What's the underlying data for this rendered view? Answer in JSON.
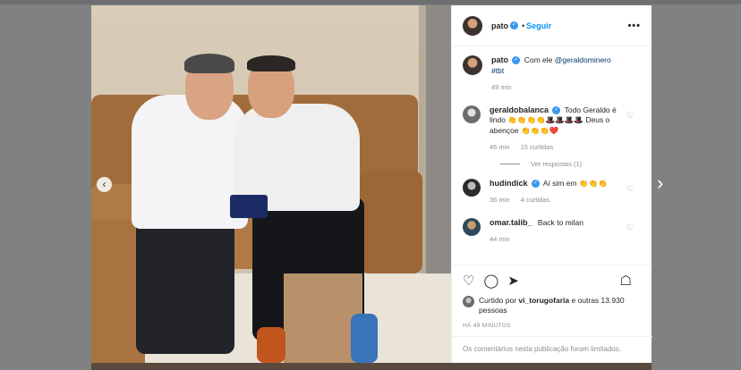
{
  "post": {
    "username": "pato",
    "follow_label": "Seguir",
    "more_label": "•••"
  },
  "caption": {
    "username": "pato",
    "text": "Com ele ",
    "mention": "@geraldominero",
    "hashtag": "#tbt",
    "time": "49 min"
  },
  "comments": [
    {
      "username": "geraldobalanca",
      "text": "Todo Geraldo é lindo 👏👏👏👏🎩🎩🎩🎩 Deus o abençoe 👏👏👏❤️",
      "time": "46 min",
      "likes": "15 curtidas"
    },
    {
      "username": "hudindick",
      "text": "Aí sim em 👏👏👏",
      "time": "36 min",
      "likes": "4 curtidas"
    },
    {
      "username": "omar.talib_",
      "text": "Back to milan",
      "time": "44 min",
      "likes": ""
    }
  ],
  "replies_label": "Ver respostas (1)",
  "liked_by": {
    "prefix": "Curtido por ",
    "user": "vi_torugofaria",
    "suffix": " e outras 13.930 pessoas"
  },
  "timestamp": "HÁ 49 MINUTOS",
  "limited_notice": "Os comentários nesta publicação foram limitados.",
  "icons": [
    "verified-badge-icon",
    "heart-icon",
    "comment-icon",
    "share-icon",
    "bookmark-icon",
    "chevron-left-icon",
    "chevron-right-icon"
  ],
  "colors": {
    "accent": "#0095f6",
    "verified": "#3897f0",
    "text": "#262626",
    "muted": "#8e8e8e"
  }
}
